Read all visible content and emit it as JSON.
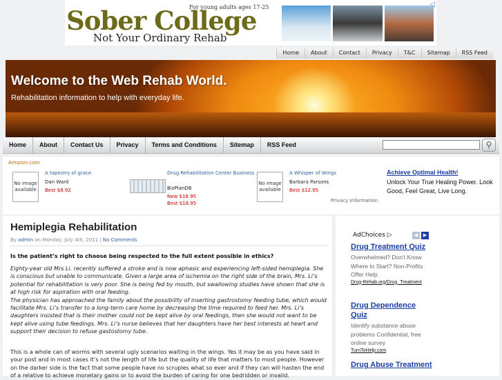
{
  "banner": {
    "tagline_small": "For young adults ages 17-25",
    "brand": "Sober College",
    "slogan": "Not Your Ordinary Rehab",
    "adchoice_icon": "adchoices-triangle-icon"
  },
  "topnav": [
    "Home",
    "About",
    "Contact",
    "Privacy",
    "T&C",
    "Sitemap",
    "RSS Feed"
  ],
  "hero": {
    "title": "Welcome to the Web Rehab World.",
    "subtitle": "Rehabilitation information to help with everyday life."
  },
  "mainnav": [
    "Home",
    "About",
    "Contact Us",
    "Privacy",
    "Terms and Conditions",
    "Sitemap",
    "RSS Feed"
  ],
  "search": {
    "placeholder": "",
    "icon": "search-icon"
  },
  "amazon": {
    "brand": "Amazon.com",
    "items": [
      {
        "image_text": "No image available",
        "title": "A tapestry of grace",
        "author": "Dan Ward",
        "price": "Best $8.92"
      },
      {
        "image_text": "",
        "title": "Drug Rehabilitation Center Business ...",
        "author": "BizPlanDB",
        "price": "New $18.95",
        "price2": "Best $18.95"
      },
      {
        "image_text": "No image available",
        "title": "A Whisper of Wings",
        "author": "Barbara Parsons",
        "price": "Best $12.95"
      }
    ],
    "privacy": "Privacy Information",
    "promo": {
      "title": "Achieve Optimal Health!",
      "text": "Unlock Your True Healing Power. Look Good, Feel Great, Live Long."
    }
  },
  "post": {
    "title": "Hemiplegia Rehabilitation",
    "meta_by": "By ",
    "author": "admin",
    "meta_date": " on Monday, July 4th, 2011 | ",
    "comments": "No Comments",
    "question": "Is the patient’s right to choose being respected to the full extent possible in ethics?",
    "case_p1": "Eighty-year old Mrs Li. recently suffered a stroke and is now aphasic and experiencing left-sided hemiplegia. She is conscious but unable to communicate. Given a large area of ischemia on the right side of the brain, Mrs. Li’s potential for rehabilitation is very poor. She is being fed by mouth, but swallowing studies have shown that she is at high risk for aspiration with oral feeding.",
    "case_p2": "The physician has approached the family about the possibility of inserting gastrostomy feeding tube, which would facilitate Mrs. Li’s transfer to a long-term care home by decreasing the time required to feed her. Mrs. Li’s daughters insisted that is their mother could not be kept alive by oral feedings, then she would not want to be kept alive using tube feedings. Mrs. Li’s nurse believes that her daughters have her best interests at heart and support their decision to refuse gastostomy tube.",
    "body": "This is a whole can of worms with several ugly scenarios waiting in the wings. Yes it may be as you have said in your post and in most cases it’s not the length of life but the quality of life that matters to most people. However on the darker side is the fact that some people have no scruples what so ever and if they can will hasten the end of a relative to achieve monetary gains or to avoid the burden of caring for one bedridden or invalid."
  },
  "sidebar": {
    "adchoices": "AdChoices",
    "ads": [
      {
        "title": "Drug Treatment Quiz",
        "body": "Overwhelmed? Don't Know Where to Start? Non-Profits Offer Help.",
        "url": "Drug-Rehab.org/Drug_Treatment"
      },
      {
        "title": "Drug Dependence Quiz",
        "body": "Identify substance abuse problems Confidential, free online survey",
        "url": "TurnToHelp.com"
      },
      {
        "title": "Drug Abuse Treatment",
        "body": "",
        "url": ""
      }
    ]
  }
}
